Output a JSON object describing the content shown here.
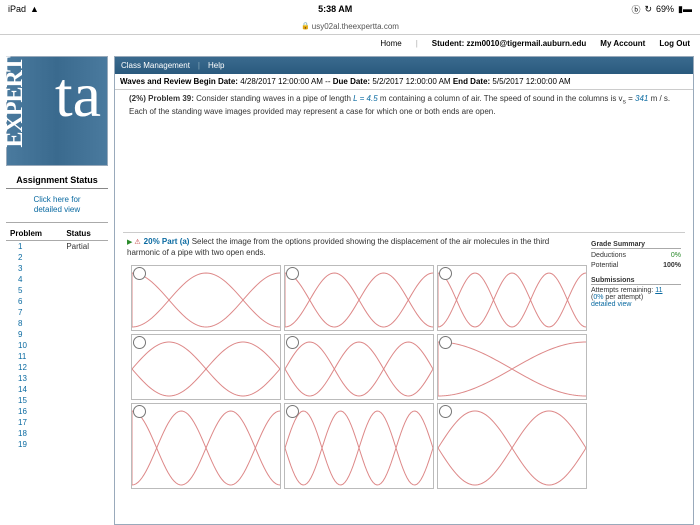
{
  "ios": {
    "device": "iPad",
    "time": "5:38 AM",
    "pct": "69%"
  },
  "url": "usy02al.theexpertta.com",
  "nav": {
    "home": "Home",
    "student": "Student: zzm0010@tigermail.auburn.edu",
    "acct": "My Account",
    "logout": "Log Out"
  },
  "band": {
    "cm": "Class Management",
    "help": "Help"
  },
  "dates": {
    "label1": "Waves and Review Begin Date:",
    "d1": "4/28/2017 12:00:00 AM",
    "sep": "--",
    "label2": "Due Date:",
    "d2": "5/2/2017 12:00:00 AM",
    "label3": "End Date:",
    "d3": "5/5/2017 12:00:00 AM"
  },
  "prob": {
    "pct": "(2%) Problem 39:",
    "t1": " Consider standing waves in a pipe of length ",
    "L": "L = 4.5",
    "t2": " m containing a column of air. The speed of sound in the columns is v",
    "sub": "s",
    "eq": " = ",
    "v": "341",
    "t3": " m / s. Each of the standing wave images provided may represent a case for which one or both ends are open."
  },
  "part": {
    "pct": "20% Part (a)",
    "q": " Select the image from the options provided showing the displacement of the air molecules in the third harmonic of a pipe with two open ends."
  },
  "sidebar": {
    "assign": "Assignment Status",
    "detail1": "Click here for",
    "detail2": "detailed view",
    "ph": "Problem",
    "st": "Status",
    "rows": [
      [
        "1",
        "Partial"
      ],
      [
        "2",
        ""
      ],
      [
        "3",
        ""
      ],
      [
        "4",
        ""
      ],
      [
        "5",
        ""
      ],
      [
        "6",
        ""
      ],
      [
        "7",
        ""
      ],
      [
        "8",
        ""
      ],
      [
        "9",
        ""
      ],
      [
        "10",
        ""
      ],
      [
        "11",
        ""
      ],
      [
        "12",
        ""
      ],
      [
        "13",
        ""
      ],
      [
        "14",
        ""
      ],
      [
        "15",
        ""
      ],
      [
        "16",
        ""
      ],
      [
        "17",
        ""
      ],
      [
        "18",
        ""
      ],
      [
        "19",
        ""
      ]
    ]
  },
  "gsum": {
    "hd": "Grade Summary",
    "ded": "Deductions",
    "dedv": "0%",
    "pot": "Potential",
    "potv": "100%",
    "sub": "Submissions",
    "att": "Attempts remaining:",
    "attv": "11",
    "per": "(0% per attempt)",
    "dv": "detailed view"
  }
}
